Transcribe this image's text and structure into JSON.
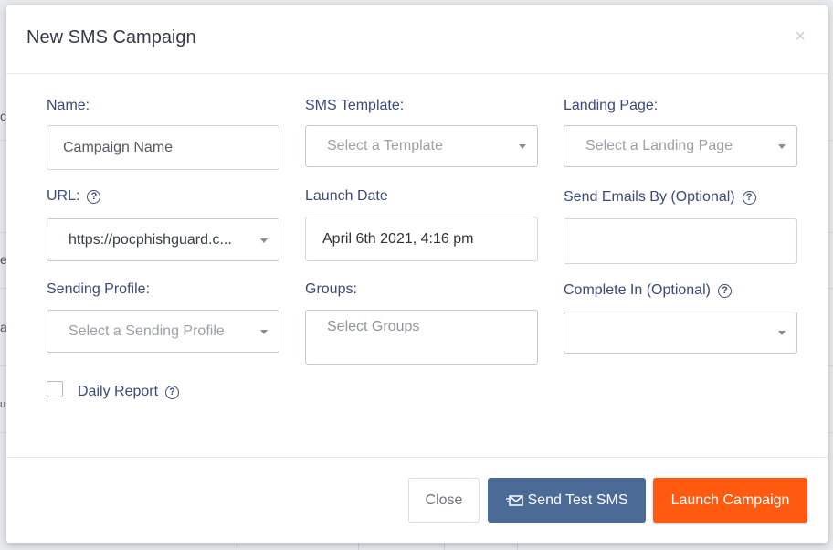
{
  "modal": {
    "title": "New SMS Campaign",
    "close_icon": "×"
  },
  "form": {
    "name": {
      "label": "Name:",
      "placeholder": "Campaign Name"
    },
    "sms_template": {
      "label": "SMS Template:",
      "placeholder": "Select a Template"
    },
    "landing_page": {
      "label": "Landing Page:",
      "placeholder": "Select a Landing Page"
    },
    "url": {
      "label": "URL:",
      "value": "https://pocphishguard.c..."
    },
    "launch_date": {
      "label": "Launch Date",
      "value": "April 6th 2021, 4:16 pm"
    },
    "send_emails_by": {
      "label": "Send Emails By (Optional)",
      "value": ""
    },
    "sending_profile": {
      "label": "Sending Profile:",
      "placeholder": "Select a Sending Profile"
    },
    "groups": {
      "label": "Groups:",
      "placeholder": "Select Groups"
    },
    "complete_in": {
      "label": "Complete In (Optional)",
      "value": ""
    },
    "daily_report": {
      "label": "Daily Report",
      "checked": false
    }
  },
  "buttons": {
    "close": "Close",
    "send_test": "Send Test SMS",
    "launch": "Launch Campaign"
  },
  "background_chars": [
    "c",
    "e",
    "a",
    "u"
  ],
  "colors": {
    "label": "#3b4a7a",
    "send_test_bg": "#4c6a96",
    "launch_bg": "#ff5a0f"
  }
}
